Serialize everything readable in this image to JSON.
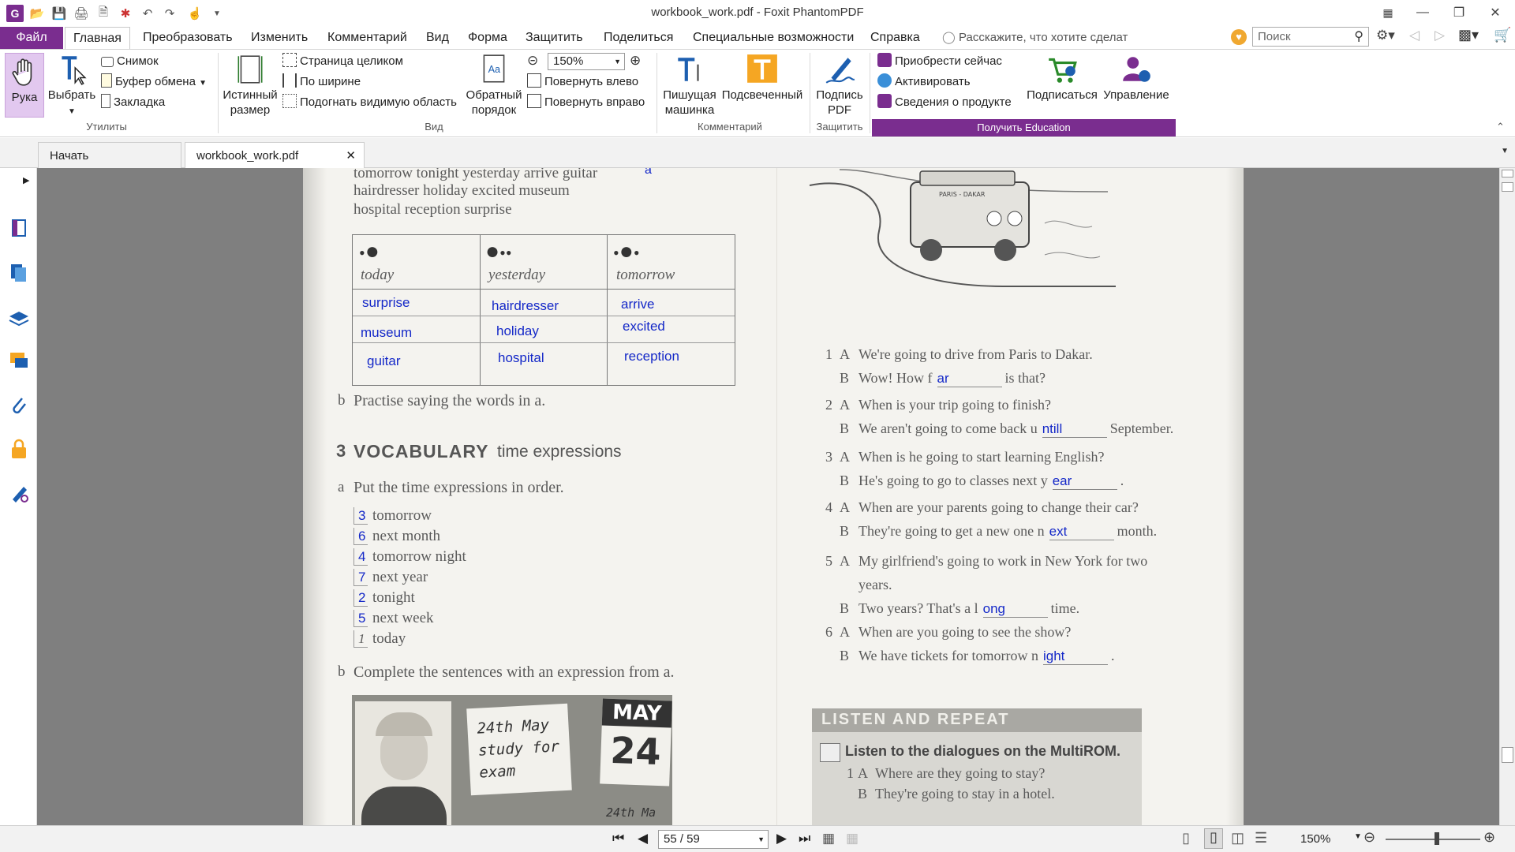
{
  "window": {
    "title": "workbook_work.pdf - Foxit PhantomPDF"
  },
  "menu": {
    "file": "Файл",
    "home": "Главная",
    "convert": "Преобразовать",
    "edit": "Изменить",
    "comment": "Комментарий",
    "view": "Вид",
    "form": "Форма",
    "protect": "Защитить",
    "share": "Поделиться",
    "accessibility": "Специальные возможности",
    "help": "Справка",
    "tell_me": "Расскажите, что хотите сделат",
    "search_placeholder": "Поиск"
  },
  "ribbon": {
    "hand": "Рука",
    "select": "Выбрать",
    "snapshot": "Снимок",
    "clipboard": "Буфер обмена",
    "bookmark": "Закладка",
    "group_utils": "Утилиты",
    "actual_size_1": "Истинный",
    "actual_size_2": "размер",
    "fit_page": "Страница целиком",
    "fit_width": "По ширине",
    "fit_visible": "Подогнать видимую область",
    "reverse_1": "Обратный",
    "reverse_2": "порядок",
    "zoom": "150%",
    "rotate_left": "Повернуть влево",
    "rotate_right": "Повернуть вправо",
    "group_view": "Вид",
    "typewriter_1": "Пишущая",
    "typewriter_2": "машинка",
    "highlight": "Подсвеченный",
    "group_comment": "Комментарий",
    "sign_1": "Подпись",
    "sign_2": "PDF",
    "group_protect": "Защитить",
    "buy": "Приобрести сейчас",
    "activate": "Активировать",
    "about": "Сведения о продукте",
    "subscribe": "Подписаться",
    "manage": "Управление",
    "group_edu": "Получить Education"
  },
  "tabs": {
    "start": "Начать",
    "doc": "workbook_work.pdf"
  },
  "status": {
    "page": "55 / 59",
    "zoom": "150%"
  },
  "colors": {
    "accent": "#7a2d8f",
    "handwriting": "#1428c8"
  },
  "page": {
    "wordlist": [
      "tomorrow   tonight   yesterday   arrive   guitar",
      "hairdresser   holiday   excited   museum",
      "hospital   reception   surprise"
    ],
    "wordlist_mark": "a",
    "table": {
      "headers": [
        "today",
        "yesterday",
        "tomorrow"
      ],
      "rows": [
        [
          "surprise",
          "hairdresser",
          "arrive"
        ],
        [
          "museum",
          "holiday",
          "excited"
        ],
        [
          "guitar",
          "hospital",
          "reception"
        ]
      ]
    },
    "practise": "Practise saying the words in a.",
    "practise_mark": "b",
    "section_num": "3",
    "section_title": "VOCABULARY",
    "section_sub": "time expressions",
    "put_mark": "a",
    "put_text": "Put the time expressions in order.",
    "order": [
      {
        "num": "3",
        "text": "tomorrow"
      },
      {
        "num": "6",
        "text": "next month"
      },
      {
        "num": "4",
        "text": "tomorrow night"
      },
      {
        "num": "7",
        "text": "next year"
      },
      {
        "num": "2",
        "text": "tonight"
      },
      {
        "num": "5",
        "text": "next week"
      },
      {
        "num": "1",
        "text": "today"
      }
    ],
    "complete_mark": "b",
    "complete_text": "Complete the sentences with an expression from a.",
    "photo_note": [
      "24th May",
      "study for",
      "exam"
    ],
    "calendar_month": "MAY",
    "calendar_day": "24",
    "calendar_partial": "24th Ma",
    "car_sign": "PARIS - DAKAR",
    "dialogues": [
      {
        "n": "1",
        "a": "We're going to drive from Paris to Dakar.",
        "b_pre": "Wow! How f",
        "b_ans": "ar",
        "b_post": "is that?"
      },
      {
        "n": "2",
        "a": "When is your trip going to finish?",
        "b_pre": "We aren't going to come back u",
        "b_ans": "ntill",
        "b_post": "September."
      },
      {
        "n": "3",
        "a": "When is he going to start learning English?",
        "b_pre": "He's going to go to classes next y",
        "b_ans": "ear",
        "b_post": "."
      },
      {
        "n": "4",
        "a": "When are your parents going to change their car?",
        "b_pre": "They're going to get a new one n",
        "b_ans": "ext",
        "b_post": "month."
      },
      {
        "n": "5",
        "a": "My girlfriend's going to work in New York for two",
        "a2": "years.",
        "b_pre": "Two years? That's a l",
        "b_ans": "ong",
        "b_post": "time."
      },
      {
        "n": "6",
        "a": "When are you going to see the show?",
        "b_pre": "We have tickets for tomorrow n",
        "b_ans": "ight",
        "b_post": "."
      }
    ],
    "listen_banner": "LISTEN AND REPEAT",
    "listen_title": "Listen to the dialogues on the MultiROM.",
    "listen_1": "Where are they going to stay?",
    "listen_2": "They're going to stay in a hotel.",
    "lbl_a": "A",
    "lbl_b": "B"
  }
}
